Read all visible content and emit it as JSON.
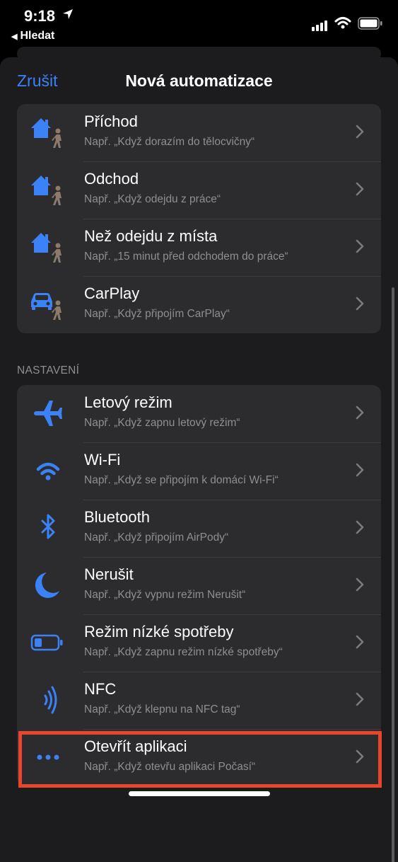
{
  "status": {
    "time": "9:18",
    "back_label": "Hledat"
  },
  "nav": {
    "cancel": "Zrušit",
    "title": "Nová automatizace"
  },
  "location_group": [
    {
      "icon": "house-person-icon",
      "title": "Příchod",
      "subtitle": "Např. „Když dorazím do tělocvičny“"
    },
    {
      "icon": "house-person-icon",
      "title": "Odchod",
      "subtitle": "Např. „Když odejdu z práce“"
    },
    {
      "icon": "house-person-icon",
      "title": "Než odejdu z místa",
      "subtitle": "Např. „15 minut před odchodem do práce“"
    },
    {
      "icon": "car-person-icon",
      "title": "CarPlay",
      "subtitle": "Např. „Když připojím CarPlay“"
    }
  ],
  "settings_header": "NASTAVENÍ",
  "settings_group": [
    {
      "icon": "airplane-icon",
      "title": "Letový režim",
      "subtitle": "Např. „Když zapnu letový režim“"
    },
    {
      "icon": "wifi-icon",
      "title": "Wi-Fi",
      "subtitle": "Např. „Když se připojím k domácí Wi-Fi“"
    },
    {
      "icon": "bluetooth-icon",
      "title": "Bluetooth",
      "subtitle": "Např. „Když připojím AirPody“"
    },
    {
      "icon": "moon-icon",
      "title": "Nerušit",
      "subtitle": "Např. „Když vypnu režim Nerušit“"
    },
    {
      "icon": "battery-icon",
      "title": "Režim nízké spotřeby",
      "subtitle": "Např. „Když zapnu režim nízké spotřeby“"
    },
    {
      "icon": "nfc-icon",
      "title": "NFC",
      "subtitle": "Např. „Když klepnu na NFC tag“"
    },
    {
      "icon": "ellipsis-icon",
      "title": "Otevřít aplikaci",
      "subtitle": "Např. „Když otevřu aplikaci Počasí“"
    }
  ],
  "colors": {
    "accent": "#3a82f6",
    "highlight": "#e8442e",
    "person": "#8c7b6b"
  }
}
